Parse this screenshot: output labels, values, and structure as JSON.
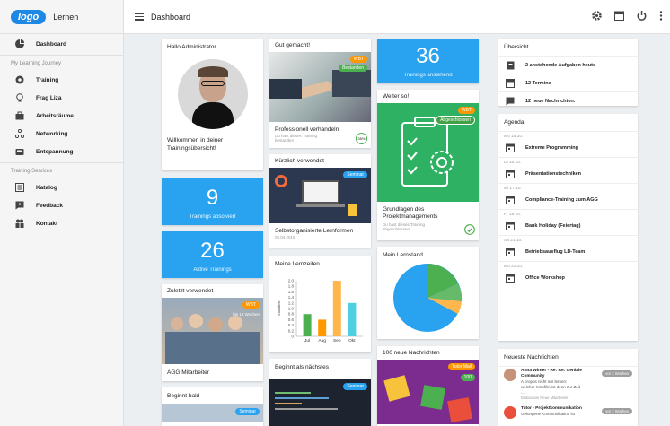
{
  "app": {
    "logo": "logo",
    "name": "Lernen",
    "title": "Dashboard"
  },
  "sidebar": {
    "items": [
      {
        "label": "Dashboard",
        "icon": "dashboard-icon"
      }
    ],
    "section1": "My Learning Journey",
    "journey": [
      {
        "label": "Training"
      },
      {
        "label": "Frag Liza"
      },
      {
        "label": "Arbeitsräume"
      },
      {
        "label": "Networking"
      },
      {
        "label": "Entspannung"
      }
    ],
    "section2": "Training Services",
    "services": [
      {
        "label": "Katalog"
      },
      {
        "label": "Feedback"
      },
      {
        "label": "Kontakt"
      }
    ]
  },
  "col1": {
    "welcome_title": "Hallo Administrator",
    "welcome_text": "Willkommen in deiner Trainingsübersicht!",
    "stat1_value": "9",
    "stat1_label": "Trainings absolviert",
    "stat2_value": "26",
    "stat2_label": "Aktive Trainings",
    "recent_title": "Zuletzt verwendet",
    "recent_badge": "WBT",
    "recent_sub": "bis 12 Wochen",
    "recent_name": "AGG Mitarbeiter",
    "next_title": "Beginnt bald",
    "next_badge": "Seminar"
  },
  "col2": {
    "good_title": "Gut gemacht!",
    "good_badge": "WBT",
    "good_status": "Bestanden",
    "good_name": "Professionell verhandeln",
    "good_note": "Du hast dieses Training bestanden",
    "good_pct": "35%",
    "used_title": "Kürzlich verwendet",
    "used_badge": "Seminar",
    "used_name": "Selbstorganisierte Lernformen",
    "used_date": "05.04.2015",
    "chart_title": "Meine Lernzeiten",
    "next_title": "Beginnt als nächstes",
    "next_badge": "Seminar"
  },
  "chart_data": {
    "type": "bar",
    "categories": [
      "Jul",
      "Aug",
      "Sep",
      "Okt"
    ],
    "values": [
      0.8,
      0.6,
      2.0,
      1.2
    ],
    "ylabel": "Stunden",
    "ylim": [
      0,
      2.0
    ],
    "yticks": [
      "2.0",
      "1.8",
      "1.6",
      "1.4",
      "1.2",
      "1.0",
      "0.8",
      "0.6",
      "0.4",
      "0.2",
      "0"
    ],
    "colors": [
      "#4caf50",
      "#ff9800",
      "#ffb74d",
      "#4dd0e1"
    ]
  },
  "col3": {
    "stat_value": "36",
    "stat_label": "Trainings anstehend",
    "weiter_title": "Weiter so!",
    "weiter_badge": "WBT",
    "weiter_status": "Abgeschlossen",
    "weiter_name": "Grundlagen des Projektmanagements",
    "weiter_note": "Du hast dieses Training abgeschlossen",
    "lernstand_title": "Mein Lernstand",
    "msg_title": "100 neue Nachrichten",
    "msg_badge": "Tutor Mail",
    "msg_count": "100"
  },
  "col4": {
    "overview_title": "Übersicht",
    "overview": [
      {
        "label": "2 anstehende Aufgaben heute"
      },
      {
        "label": "12 Termine"
      },
      {
        "label": "12 neue Nachrichten."
      }
    ],
    "agenda_title": "Agenda",
    "agenda": [
      {
        "date": "Mo 15.10.",
        "label": "Extreme Programming"
      },
      {
        "date": "Di 16.10.",
        "label": "Präsentationstechniken"
      },
      {
        "date": "Mi 17.10.",
        "label": "Compliance-Training zum AGG"
      },
      {
        "date": "Fr 19.10.",
        "label": "Bank Holiday (Feiertag)"
      },
      {
        "date": "Sa 21.10.",
        "label": "Betriebsausflug LD-Team"
      },
      {
        "date": "Mo 22.10.",
        "label": "Office Workshop"
      }
    ],
    "news_title": "Neueste Nachrichten",
    "news": [
      {
        "title": "Anna Winter - Re: Re: Geniale Community",
        "text": "A propos nicht nur lernen: welcher Kinofilm ist denn zur Zeit ...",
        "meta": "Diskussion Neue Mitarbeiter",
        "time": "vor 2 Wochen"
      },
      {
        "title": "Tutor - Projektkommunikation",
        "text": "Gelungene Kommunikation ist",
        "meta": "",
        "time": "vor 2 Wochen"
      }
    ]
  }
}
